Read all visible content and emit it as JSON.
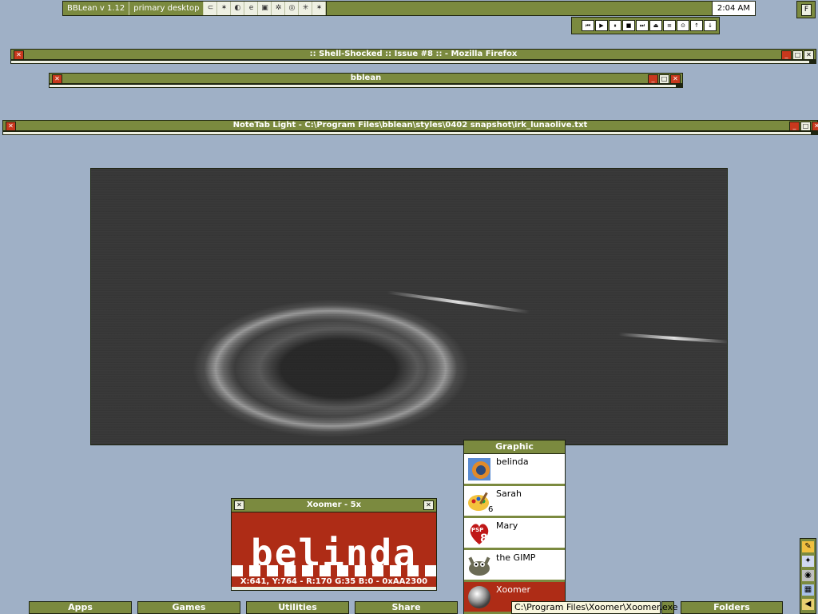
{
  "toolbar": {
    "app_name": "BBLean v 1.12",
    "workspace": "primary desktop",
    "tray_icons": [
      "drive-icon",
      "satellite-icon",
      "firefox-icon",
      "ie-icon",
      "shield-icon",
      "ghost-icon",
      "bug-icon",
      "palette-icon",
      "satellite-icon"
    ],
    "clock": "2:04 AM",
    "f_label": "F"
  },
  "media_controls": [
    "⏮",
    "▶",
    "⏸",
    "■",
    "⏭",
    "⏏",
    "≡",
    "⊙",
    "↑",
    "↓"
  ],
  "windows": [
    {
      "title": ":: Shell-Shocked :: Issue #8 :: - Mozilla Firefox"
    },
    {
      "title": "bblean"
    },
    {
      "title": "NoteTab Light  -  C:\\Program Files\\bblean\\styles\\0402 snapshot\\irk_lunaolive.txt"
    }
  ],
  "xoomer": {
    "title": "Xoomer - 5x",
    "zoom_text": "belinda",
    "info": "X:641, Y:764  -  R:170 G:35 B:0  -  0xAA2300"
  },
  "graphic_menu": {
    "title": "Graphic",
    "items": [
      {
        "label": "belinda",
        "icon": "belinda-icon"
      },
      {
        "label": "Sarah",
        "icon": "sarah-paint-icon",
        "badge": "6"
      },
      {
        "label": "Mary",
        "icon": "psp8-icon"
      },
      {
        "label": "the GIMP",
        "icon": "gimp-icon"
      },
      {
        "label": "Xoomer",
        "icon": "xoomer-icon"
      }
    ]
  },
  "tooltip": "C:\\Program Files\\Xoomer\\Xoomer.exe",
  "bottom_buttons": [
    "Apps",
    "Games",
    "Utilities",
    "Share",
    "Folders"
  ],
  "colors": {
    "desktop": "#9fb0c6",
    "olive": "#7b8a3f",
    "cream": "#eef0e2",
    "accent_red": "#ae2c16"
  }
}
